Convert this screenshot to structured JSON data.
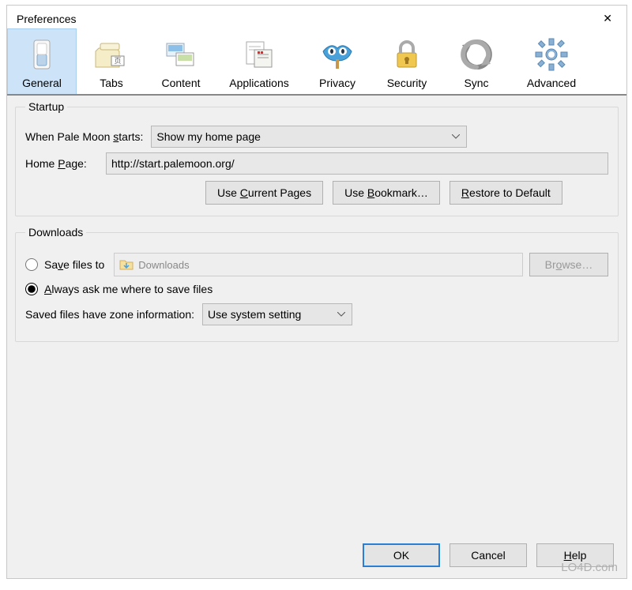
{
  "window": {
    "title": "Preferences"
  },
  "toolbar": {
    "items": [
      {
        "label": "General",
        "selected": true
      },
      {
        "label": "Tabs",
        "selected": false
      },
      {
        "label": "Content",
        "selected": false
      },
      {
        "label": "Applications",
        "selected": false
      },
      {
        "label": "Privacy",
        "selected": false
      },
      {
        "label": "Security",
        "selected": false
      },
      {
        "label": "Sync",
        "selected": false
      },
      {
        "label": "Advanced",
        "selected": false
      }
    ]
  },
  "startup": {
    "legend": "Startup",
    "whenStartsLabel": "When Pale Moon starts:",
    "whenStartsValue": "Show my home page",
    "homePageLabel": "Home Page:",
    "homePageValue": "http://start.palemoon.org/",
    "useCurrent": "Use Current Pages",
    "useBookmark": "Use Bookmark…",
    "restoreDefault": "Restore to Default"
  },
  "downloads": {
    "legend": "Downloads",
    "saveFilesLabel": "Save files to",
    "savePath": "Downloads",
    "browse": "Browse…",
    "alwaysAskLabel": "Always ask me where to save files",
    "zoneLabel": "Saved files have zone information:",
    "zoneValue": "Use system setting"
  },
  "footer": {
    "ok": "OK",
    "cancel": "Cancel",
    "help": "Help"
  },
  "watermark": "LO4D.com"
}
